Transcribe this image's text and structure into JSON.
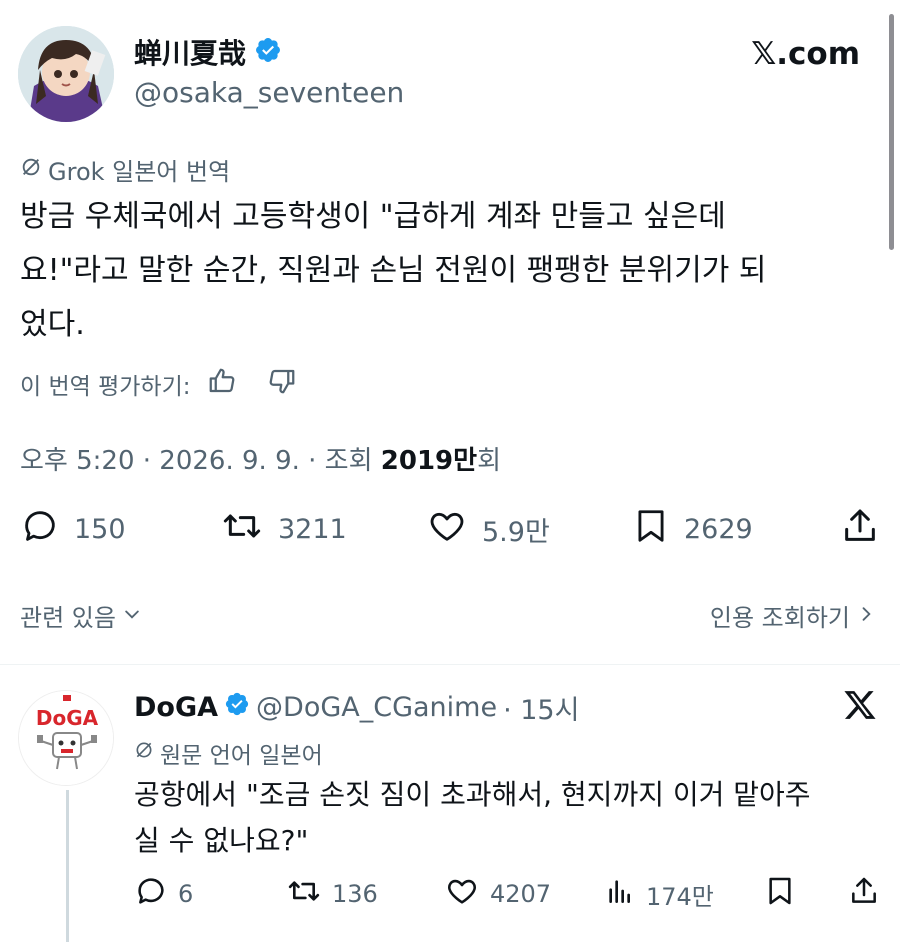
{
  "tweet": {
    "author": {
      "name": "蝉川夏哉",
      "handle": "@osaka_seventeen",
      "verified": true
    },
    "source_badge": "𝕏.com",
    "translation_label": "Grok 일본어 번역",
    "text_lines": [
      "방금 우체국에서 고등학생이 \"급하게 계좌 만들고 싶은데",
      "요!\"라고 말한 순간, 직원과 손님 전원이 팽팽한 분위기가 되",
      "었다."
    ],
    "rate_label": "이 번역 평가하기:",
    "meta": {
      "time": "오후 5:20",
      "separator": "·",
      "date": "2026. 9. 9.",
      "views_prefix": "조회",
      "views_value": "2019만",
      "views_suffix": "회"
    },
    "actions": {
      "replies": "150",
      "reposts": "3211",
      "likes": "5.9만",
      "bookmarks": "2629"
    },
    "related_label": "관련 있음",
    "quotes_label": "인용 조회하기"
  },
  "reply": {
    "author": {
      "name": "DoGA",
      "handle": "@DoGA_CGanime",
      "time": "· 15시",
      "verified": true
    },
    "logo_text": "DoGA",
    "language_label": "원문 언어 일본어",
    "text_lines": [
      "공항에서 \"조금 손짓 짐이 초과해서, 현지까지 이거 맡아주",
      "실 수 없나요?\""
    ],
    "actions": {
      "replies": "6",
      "reposts": "136",
      "likes": "4207",
      "views": "174만"
    }
  },
  "colors": {
    "text": "#0f1419",
    "muted": "#536471",
    "verified": "#1d9bf0",
    "divider": "#eff3f4",
    "doga_red": "#d8262c"
  },
  "icons": [
    "verified-badge-icon",
    "grok-icon",
    "thumbs-up-icon",
    "thumbs-down-icon",
    "reply-icon",
    "repost-icon",
    "like-icon",
    "bookmark-icon",
    "share-icon",
    "chevron-down-icon",
    "chevron-right-icon",
    "x-logo-icon",
    "views-icon"
  ]
}
